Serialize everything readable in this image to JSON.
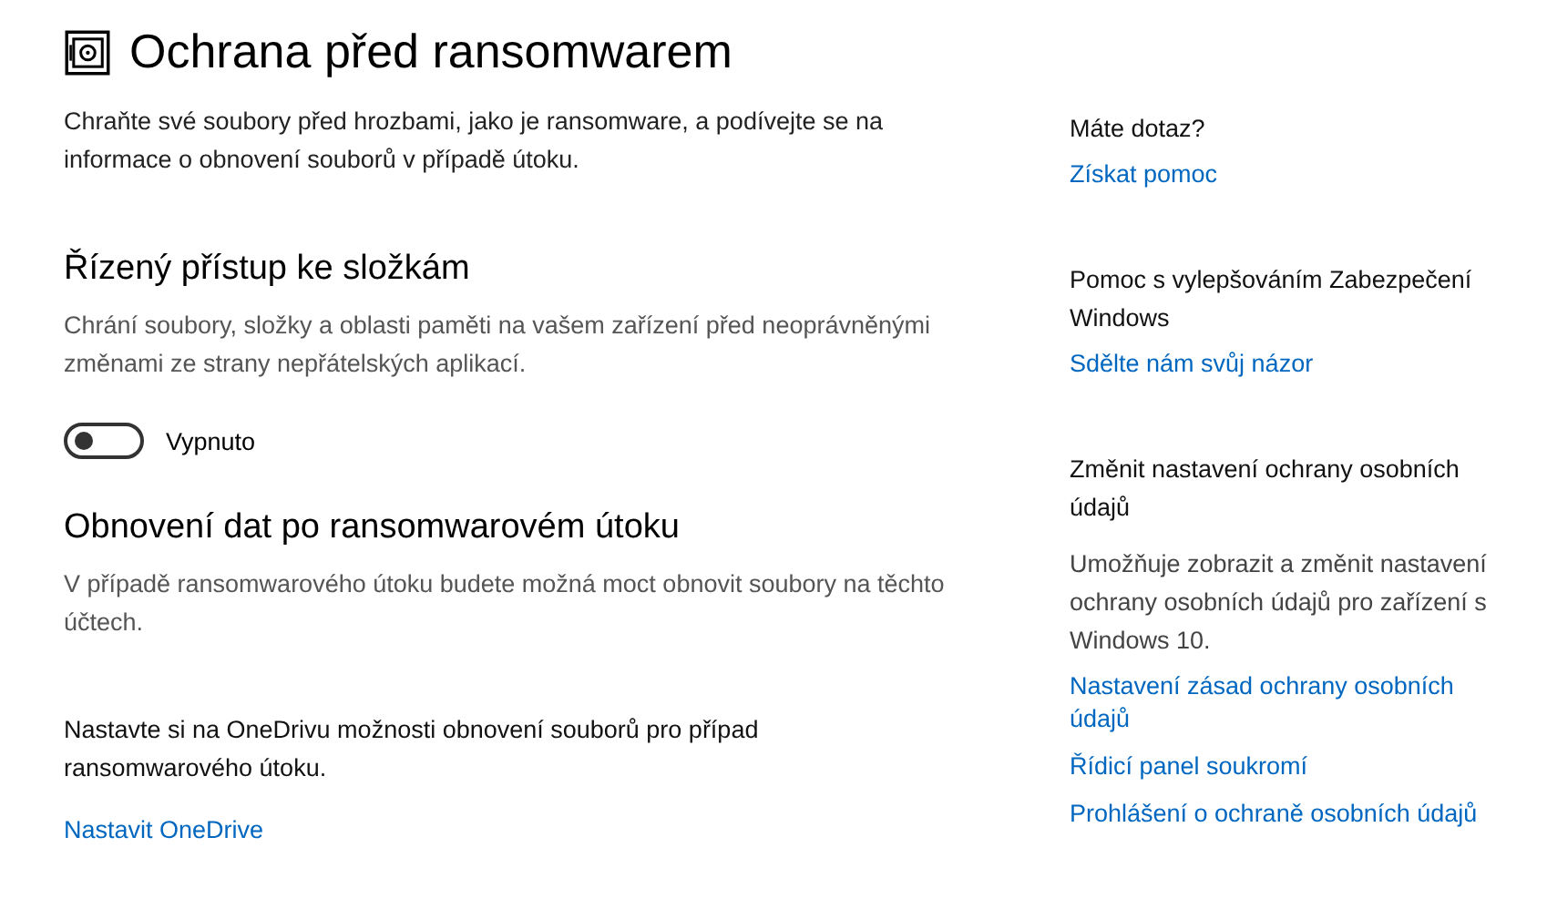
{
  "title": "Ochrana před ransomwarem",
  "intro": "Chraňte své soubory před hrozbami, jako je ransomware, a podívejte se na informace o obnovení souborů v případě útoku.",
  "controlled_access": {
    "heading": "Řízený přístup ke složkám",
    "description": "Chrání soubory, složky a oblasti paměti na vašem zařízení před neoprávněnými změnami ze strany nepřátelských aplikací.",
    "toggle": {
      "on": false,
      "label": "Vypnuto"
    }
  },
  "recovery": {
    "heading": "Obnovení dat po ransomwarovém útoku",
    "description": "V případě ransomwarového útoku budete možná moct obnovit soubory na těchto účtech.",
    "note": "Nastavte si na OneDrivu možnosti obnovení souborů pro případ ransomwarového útoku.",
    "link": "Nastavit OneDrive"
  },
  "sidebar": [
    {
      "heading": "Máte dotaz?",
      "links": [
        "Získat pomoc"
      ]
    },
    {
      "heading": "Pomoc s vylepšováním Zabezpečení Windows",
      "links": [
        "Sdělte nám svůj názor"
      ]
    },
    {
      "heading": "Změnit nastavení ochrany osobních údajů",
      "description": "Umožňuje zobrazit a změnit nastavení ochrany osobních údajů pro zařízení s Windows 10.",
      "links": [
        "Nastavení zásad ochrany osobních údajů",
        "Řídicí panel soukromí",
        "Prohlášení o ochraně osobních údajů"
      ]
    }
  ]
}
